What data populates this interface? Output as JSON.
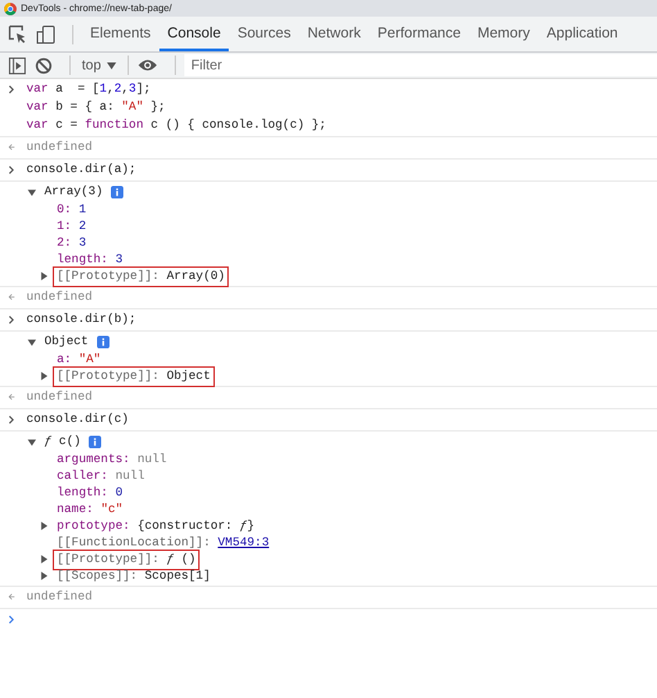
{
  "window": {
    "title": "DevTools - chrome://new-tab-page/"
  },
  "tabs": [
    {
      "label": "Elements",
      "selected": false
    },
    {
      "label": "Console",
      "selected": true
    },
    {
      "label": "Sources",
      "selected": false
    },
    {
      "label": "Network",
      "selected": false
    },
    {
      "label": "Performance",
      "selected": false
    },
    {
      "label": "Memory",
      "selected": false
    },
    {
      "label": "Application",
      "selected": false
    }
  ],
  "toolbar": {
    "context": "top",
    "filter": {
      "placeholder": "Filter"
    }
  },
  "entries": [
    {
      "kind": "input",
      "lines": [
        [
          {
            "t": "var",
            "kind": "keyword"
          },
          {
            "t": " a  = [",
            "kind": "plain"
          },
          {
            "t": "1",
            "kind": "number"
          },
          {
            "t": ",",
            "kind": "plain"
          },
          {
            "t": "2",
            "kind": "number"
          },
          {
            "t": ",",
            "kind": "plain"
          },
          {
            "t": "3",
            "kind": "number"
          },
          {
            "t": "];",
            "kind": "plain"
          }
        ],
        [
          {
            "t": "var",
            "kind": "keyword"
          },
          {
            "t": " b = { a: ",
            "kind": "plain"
          },
          {
            "t": "\"A\"",
            "kind": "string"
          },
          {
            "t": " };",
            "kind": "plain"
          }
        ],
        [
          {
            "t": "var",
            "kind": "keyword"
          },
          {
            "t": " c = ",
            "kind": "plain"
          },
          {
            "t": "function",
            "kind": "keyword"
          },
          {
            "t": " c () { console.log(c) };",
            "kind": "plain"
          }
        ]
      ]
    },
    {
      "kind": "result",
      "text": "undefined"
    },
    {
      "kind": "input",
      "lines": [
        [
          {
            "t": "console.dir(a);",
            "kind": "plain"
          }
        ]
      ]
    },
    {
      "kind": "tree",
      "header": "Array(3)",
      "expanded": true,
      "props": [
        {
          "key": {
            "t": "0:",
            "kind": "own"
          },
          "value": {
            "t": "1",
            "kind": "number"
          },
          "expandable": false,
          "highlighted": false
        },
        {
          "key": {
            "t": "1:",
            "kind": "own"
          },
          "value": {
            "t": "2",
            "kind": "number"
          },
          "expandable": false,
          "highlighted": false
        },
        {
          "key": {
            "t": "2:",
            "kind": "own"
          },
          "value": {
            "t": "3",
            "kind": "number"
          },
          "expandable": false,
          "highlighted": false
        },
        {
          "key": {
            "t": "length:",
            "kind": "own"
          },
          "value": {
            "t": "3",
            "kind": "number"
          },
          "expandable": false,
          "highlighted": false
        },
        {
          "key": {
            "t": "[[Prototype]]:",
            "kind": "internal"
          },
          "value": {
            "t": "Array(0)",
            "kind": "object"
          },
          "expandable": true,
          "highlighted": true
        }
      ]
    },
    {
      "kind": "result",
      "text": "undefined"
    },
    {
      "kind": "input",
      "lines": [
        [
          {
            "t": "console.dir(b);",
            "kind": "plain"
          }
        ]
      ]
    },
    {
      "kind": "tree",
      "header": "Object",
      "expanded": true,
      "props": [
        {
          "key": {
            "t": "a:",
            "kind": "own"
          },
          "value": {
            "t": "\"A\"",
            "kind": "string"
          },
          "expandable": false,
          "highlighted": false
        },
        {
          "key": {
            "t": "[[Prototype]]:",
            "kind": "internal"
          },
          "value": {
            "t": "Object",
            "kind": "object"
          },
          "expandable": true,
          "highlighted": true
        }
      ]
    },
    {
      "kind": "result",
      "text": "undefined"
    },
    {
      "kind": "input",
      "lines": [
        [
          {
            "t": "console.dir(c)",
            "kind": "plain"
          }
        ]
      ]
    },
    {
      "kind": "tree",
      "header": "*ƒ* c()",
      "expanded": true,
      "props": [
        {
          "key": {
            "t": "arguments:",
            "kind": "own"
          },
          "value": {
            "t": "null",
            "kind": "null"
          },
          "expandable": false,
          "highlighted": false
        },
        {
          "key": {
            "t": "caller:",
            "kind": "own"
          },
          "value": {
            "t": "null",
            "kind": "null"
          },
          "expandable": false,
          "highlighted": false
        },
        {
          "key": {
            "t": "length:",
            "kind": "own"
          },
          "value": {
            "t": "0",
            "kind": "number"
          },
          "expandable": false,
          "highlighted": false
        },
        {
          "key": {
            "t": "name:",
            "kind": "own"
          },
          "value": {
            "t": "\"c\"",
            "kind": "string"
          },
          "expandable": false,
          "highlighted": false
        },
        {
          "key": {
            "t": "prototype:",
            "kind": "own"
          },
          "value": {
            "t": "{constructor: *ƒ*}",
            "kind": "object"
          },
          "expandable": true,
          "highlighted": false
        },
        {
          "key": {
            "t": "[[FunctionLocation]]:",
            "kind": "internal"
          },
          "value": {
            "t": "VM549:3",
            "kind": "link"
          },
          "expandable": false,
          "highlighted": false
        },
        {
          "key": {
            "t": "[[Prototype]]:",
            "kind": "internal"
          },
          "value": {
            "t": "*ƒ* ()",
            "kind": "object"
          },
          "expandable": true,
          "highlighted": true
        },
        {
          "key": {
            "t": "[[Scopes]]:",
            "kind": "internal"
          },
          "value": {
            "t": "Scopes[1]",
            "kind": "object"
          },
          "expandable": true,
          "highlighted": false
        }
      ]
    },
    {
      "kind": "result",
      "text": "undefined"
    },
    {
      "kind": "prompt"
    }
  ]
}
